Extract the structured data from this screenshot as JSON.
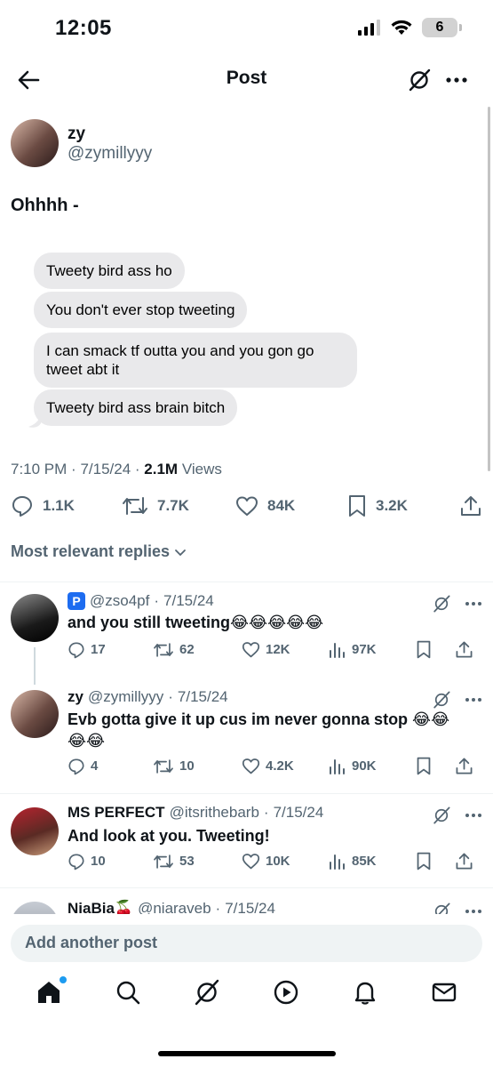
{
  "status_bar": {
    "time": "12:05",
    "battery": "6"
  },
  "header": {
    "title": "Post"
  },
  "post": {
    "author_name": "zy",
    "author_handle": "@zymillyyy",
    "text": "Ohhhh -",
    "messages": [
      "Tweety bird ass ho",
      "You don't ever stop tweeting",
      "I can smack tf outta you and you gon go tweet abt it",
      "Tweety bird ass brain bitch"
    ],
    "time": "7:10 PM",
    "date": "7/15/24",
    "views_count": "2.1M",
    "views_label": "Views",
    "replies": "1.1K",
    "reposts": "7.7K",
    "likes": "84K",
    "bookmarks": "3.2K"
  },
  "sort_label": "Most relevant replies",
  "replies": [
    {
      "badge": "P",
      "name": "",
      "handle": "@zso4pf",
      "date": "7/15/24",
      "text": "and you still tweeting😂😂😂😂😂",
      "replies": "17",
      "reposts": "62",
      "likes": "12K",
      "views": "97K"
    },
    {
      "name": "zy",
      "handle": "@zymillyyy",
      "date": "7/15/24",
      "text": "Evb gotta give it up cus im never gonna stop 😂😂😂😂",
      "replies": "4",
      "reposts": "10",
      "likes": "4.2K",
      "views": "90K"
    },
    {
      "name": "MS PERFECT",
      "handle": "@itsrithebarb",
      "date": "7/15/24",
      "text": "And look at you. Tweeting!",
      "replies": "10",
      "reposts": "53",
      "likes": "10K",
      "views": "85K"
    },
    {
      "name": "NiaBia🍒",
      "handle": "@niaraveb",
      "date": "7/15/24"
    }
  ],
  "composer": {
    "placeholder": "Add another post"
  },
  "icons": {
    "back": "back-arrow-icon",
    "grok": "grok-icon",
    "more": "more-icon",
    "reply": "reply-icon",
    "repost": "repost-icon",
    "like": "heart-icon",
    "bookmark": "bookmark-icon",
    "share": "share-icon",
    "views": "views-icon",
    "tabs": [
      "home-icon",
      "search-icon",
      "grok-icon",
      "video-icon",
      "bell-icon",
      "mail-icon"
    ]
  },
  "colors": {
    "text": "#0f1419",
    "secondary": "#536471",
    "accent": "#1d9bf0",
    "bubble": "#e9e9eb"
  }
}
